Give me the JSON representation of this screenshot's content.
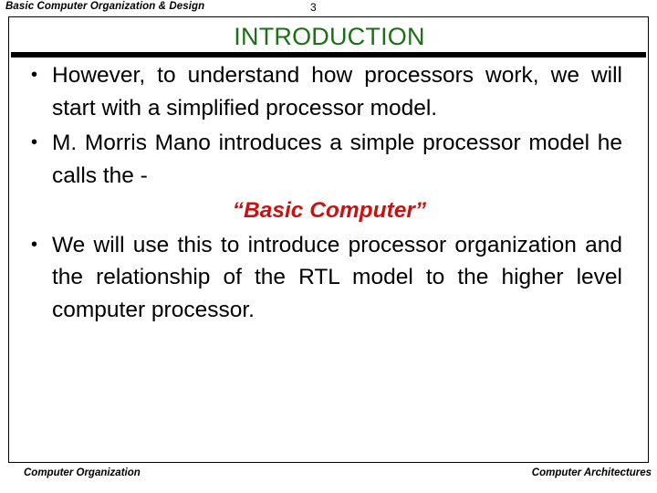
{
  "header": {
    "title": "Basic Computer Organization & Design",
    "page_number": "3"
  },
  "slide": {
    "title": "INTRODUCTION",
    "title_color": "#1a7014",
    "accent_red": "#cc1111",
    "bullets": [
      "However, to understand how processors work, we will start with a simplified processor model.",
      "M. Morris Mano introduces a simple processor model he calls the -",
      "We will use this to introduce processor organization and the relationship of the RTL model to the higher level computer processor."
    ],
    "quote": "“Basic Computer”"
  },
  "footer": {
    "left": "Computer Organization",
    "right": "Computer Architectures"
  }
}
